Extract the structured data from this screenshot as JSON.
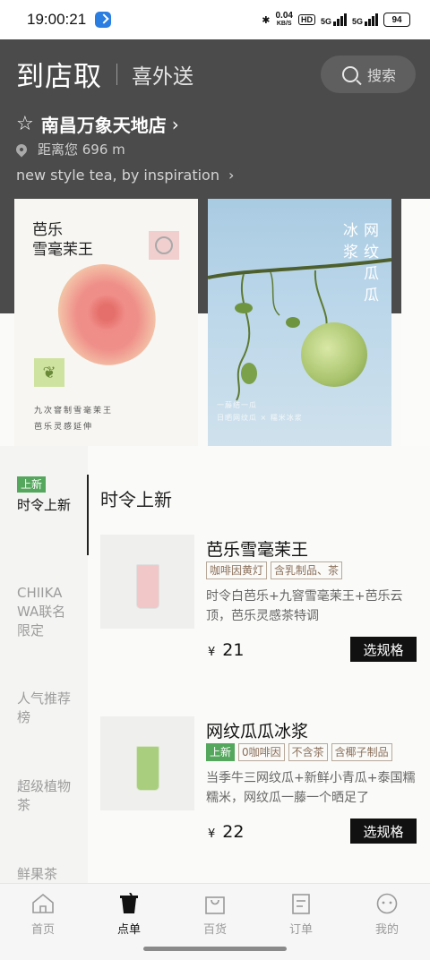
{
  "status_bar": {
    "time": "19:00:21",
    "net_speed_value": "0.04",
    "net_speed_unit": "KB/S",
    "hd_label": "HD",
    "sig1_label": "5G",
    "sig2_label": "5G",
    "battery": "94"
  },
  "header": {
    "pickup_tab": "到店取",
    "delivery_tab": "喜外送",
    "search_label": "搜索",
    "store_name": "南昌万象天地店",
    "distance": "距离您 696 m",
    "slogan": "new style tea, by inspiration"
  },
  "banners": [
    {
      "title_lines": [
        "芭乐",
        "雪毫茉王"
      ],
      "caption_lines": [
        "九次窨制雪毫茉王",
        "芭乐灵感延伸"
      ]
    },
    {
      "title_cols": [
        [
          "冰",
          "浆"
        ],
        [
          "网",
          "纹",
          "瓜",
          "瓜"
        ]
      ],
      "caption_lines": [
        "一藤结一瓜",
        "日晒网纹瓜 × 糯米冰浆"
      ]
    }
  ],
  "categories": [
    {
      "badge": "上新",
      "label": "时令上新",
      "active": true
    },
    {
      "label": "CHIIKAWA联名限定",
      "active": false
    },
    {
      "label": "人气推荐榜",
      "active": false
    },
    {
      "label": "超级植物茶",
      "active": false
    },
    {
      "label": "鲜果茶",
      "active": false
    }
  ],
  "section_title": "时令上新",
  "products": [
    {
      "name": "芭乐雪毫茉王",
      "tags": [
        {
          "text": "咖啡因黄灯",
          "new": false
        },
        {
          "text": "含乳制品、茶",
          "new": false
        }
      ],
      "description": "时令白芭乐+九窨雪毫茉王+芭乐云顶，芭乐灵感茶特调",
      "currency": "¥",
      "price": "21",
      "button": "选规格",
      "cup_color": "#f2c7c8"
    },
    {
      "name": "网纹瓜瓜冰浆",
      "tags": [
        {
          "text": "上新",
          "new": true
        },
        {
          "text": "0咖啡因",
          "new": false
        },
        {
          "text": "不含茶",
          "new": false
        },
        {
          "text": "含椰子制品",
          "new": false
        }
      ],
      "description": "当季牛三网纹瓜+新鲜小青瓜+泰国糯糯米，网纹瓜一藤一个晒足了",
      "currency": "¥",
      "price": "22",
      "button": "选规格",
      "cup_color": "#a9cf7e"
    }
  ],
  "nav": [
    {
      "label": "首页",
      "icon": "home-icon",
      "active": false
    },
    {
      "label": "点单",
      "icon": "cup-icon",
      "active": true
    },
    {
      "label": "百货",
      "icon": "shopping-bag-icon",
      "active": false
    },
    {
      "label": "订单",
      "icon": "order-list-icon",
      "active": false
    },
    {
      "label": "我的",
      "icon": "profile-face-icon",
      "active": false
    }
  ],
  "colors": {
    "header_bg": "#4b4b4b",
    "new_badge_green": "#55a75d",
    "button_black": "#111111"
  }
}
